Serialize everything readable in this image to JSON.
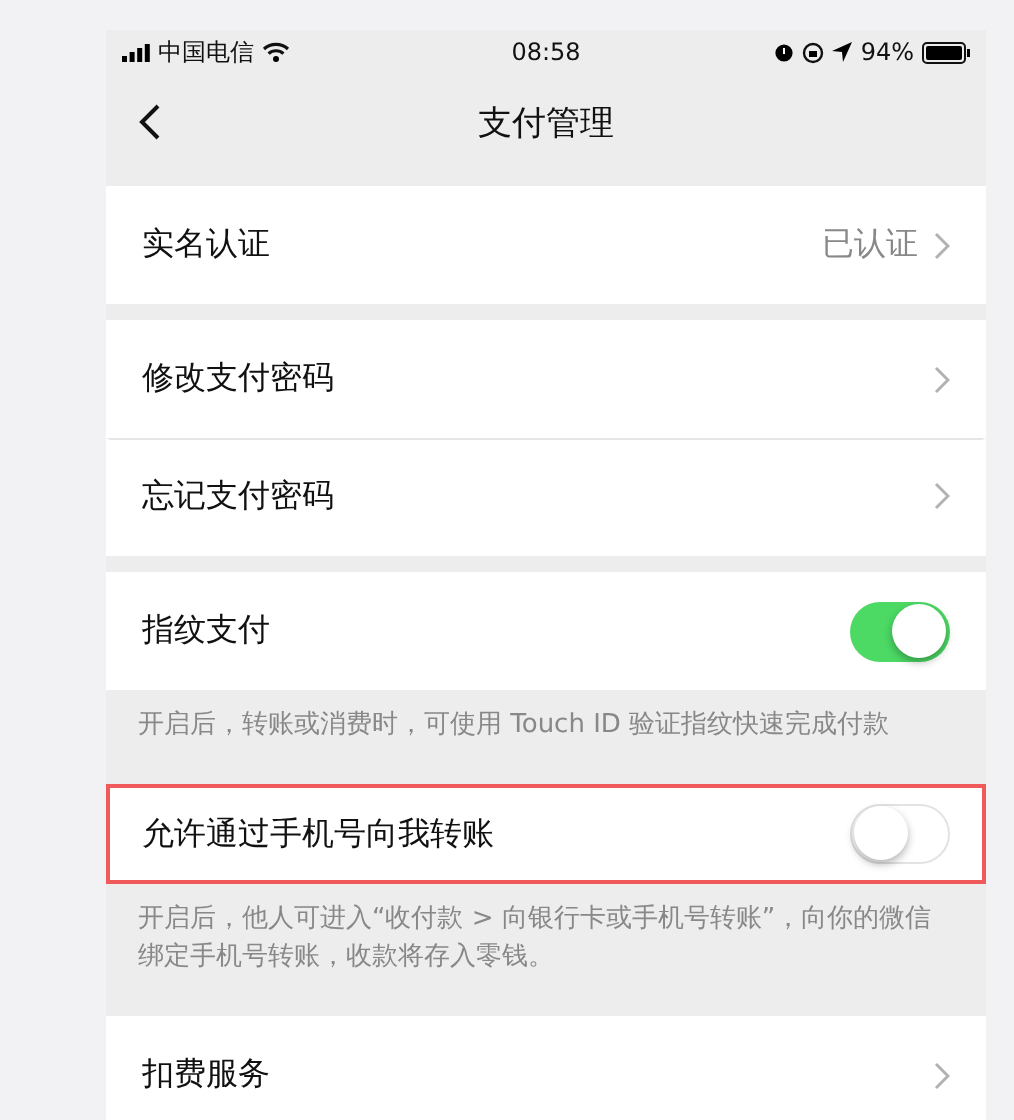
{
  "status_bar": {
    "carrier": "中国电信",
    "time": "08:58",
    "battery": "94%"
  },
  "nav": {
    "title": "支付管理"
  },
  "groups": [
    {
      "items": [
        {
          "kind": "link",
          "label": "实名认证",
          "value": "已认证"
        }
      ]
    },
    {
      "items": [
        {
          "kind": "link",
          "label": "修改支付密码"
        },
        {
          "kind": "link",
          "label": "忘记支付密码"
        }
      ]
    },
    {
      "items": [
        {
          "kind": "toggle",
          "label": "指纹支付",
          "on": true,
          "highlighted": false
        }
      ],
      "note": "开启后，转账或消费时，可使用 Touch ID 验证指纹快速完成付款"
    },
    {
      "items": [
        {
          "kind": "toggle",
          "label": "允许通过手机号向我转账",
          "on": false,
          "highlighted": true
        }
      ],
      "note": "开启后，他人可进入“收付款 > 向银行卡或手机号转账”，向你的微信绑定手机号转账，收款将存入零钱。"
    },
    {
      "items": [
        {
          "kind": "link",
          "label": "扣费服务"
        }
      ]
    }
  ]
}
